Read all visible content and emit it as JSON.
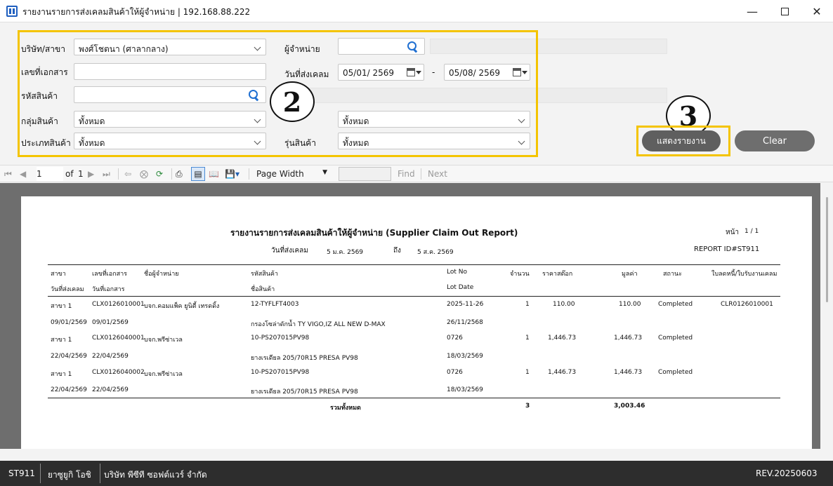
{
  "window": {
    "title": "รายงานรายการส่งเคลมสินค้าให้ผู้จำหน่าย | 192.168.88.222",
    "minimize_icon": "minimize-icon",
    "maximize_icon": "maximize-icon",
    "close_icon": "close-icon"
  },
  "filters": {
    "branch_label": "บริษัท/สาขา",
    "branch_value": "พงศ์โชตนา (ศาลากลาง)",
    "doc_no_label": "เลขที่เอกสาร",
    "doc_no_value": "",
    "product_code_label": "รหัสสินค้า",
    "product_code_value": "",
    "product_group_label": "กลุ่มสินค้า",
    "product_group_value": "ทั้งหมด",
    "product_type_label": "ประเภทสินค้า",
    "product_type_value": "ทั้งหมด",
    "supplier_label": "ผู้จำหน่าย",
    "supplier_value": "",
    "date_label": "วันที่ส่งเคลม",
    "date_from": "05/01/  2569",
    "date_sep": "-",
    "date_to": "05/08/  2569",
    "brand_value": "ทั้งหมด",
    "model_label": "รุ่นสินค้า",
    "model_value": "ทั้งหมด"
  },
  "callouts": {
    "filters": "2",
    "show_button": "3"
  },
  "buttons": {
    "show_report": "แสดงรายงาน",
    "clear": "Clear"
  },
  "colors": {
    "highlight": "#f4c400",
    "show_button": "#5f5f5f",
    "clear_button": "#6e6e6e",
    "status_bar": "#2d2d2d"
  },
  "viewer_toolbar": {
    "page_current": "1",
    "page_of": "of",
    "page_total": "1",
    "zoom": "Page Width",
    "find_placeholder": "",
    "find_label": "Find",
    "next_label": "Next"
  },
  "report": {
    "title": "รายงานรายการส่งเคลมสินค้าให้ผู้จำหน่าย (Supplier Claim Out Report)",
    "page_label": "หน้า",
    "page_value": "1 / 1",
    "date_range_label": "วันที่ส่งเคลม",
    "date_from": "5 ม.ค. 2569",
    "to_label": "ถึง",
    "date_to": "5 ส.ค. 2569",
    "report_id": "REPORT ID#ST911",
    "headers": {
      "branch": "สาขา",
      "doc_no": "เลขที่เอกสาร",
      "supplier": "ชื่อผู้จำหน่าย",
      "product_code": "รหัสสินค้า",
      "lot_no": "Lot No",
      "qty": "จำนวน",
      "cost": "ราคาสต๊อก",
      "amount": "มูลค่า",
      "status": "สถานะ",
      "receipt": "ใบลดหนี้/ใบรับงานเคลม",
      "claim_date": "วันที่ส่งเคลม",
      "doc_date": "วันที่เอกสาร",
      "product_name": "ชื่อสินค้า",
      "lot_date": "Lot Date"
    },
    "rows": [
      {
        "branch": "สาขา 1",
        "doc_no": "CLX0126010001",
        "supplier": "บจก.คอมแพ็ค ยูนิตี้ เทรดดิ้ง",
        "product_code": "12-TYFLFT4003",
        "lot_no": "2025-11-26",
        "qty": "1",
        "cost": "110.00",
        "amount": "110.00",
        "status": "Completed",
        "receipt": "CLR0126010001",
        "claim_date": "09/01/2569",
        "doc_date": "09/01/2569",
        "product_name": "กรองโซล่าดักน้ำ TY VIGO,IZ ALL NEW D-MAX",
        "lot_date": "26/11/2568"
      },
      {
        "branch": "สาขา 1",
        "doc_no": "CLX0126040001",
        "supplier": "บจก.พรีซ่าเวล",
        "product_code": "10-PS207015PV98",
        "lot_no": "0726",
        "qty": "1",
        "cost": "1,446.73",
        "amount": "1,446.73",
        "status": "Completed",
        "receipt": "",
        "claim_date": "22/04/2569",
        "doc_date": "22/04/2569",
        "product_name": "ยางเรเดียล 205/70R15 PRESA PV98",
        "lot_date": "18/03/2569"
      },
      {
        "branch": "สาขา 1",
        "doc_no": "CLX0126040002",
        "supplier": "บจก.พรีซ่าเวล",
        "product_code": "10-PS207015PV98",
        "lot_no": "0726",
        "qty": "1",
        "cost": "1,446.73",
        "amount": "1,446.73",
        "status": "Completed",
        "receipt": "",
        "claim_date": "22/04/2569",
        "doc_date": "22/04/2569",
        "product_name": "ยางเรเดียล 205/70R15 PRESA PV98",
        "lot_date": "18/03/2569"
      }
    ],
    "total_label": "รวมทั้งหมด",
    "total_qty": "3",
    "total_amount": "3,003.46"
  },
  "status_bar": {
    "report_code": "ST911",
    "user": "ยาซูยูกิ  โอชิ",
    "company": "บริษัท พีซีที ซอฟต์แวร์ จำกัด",
    "revision": "REV.20250603"
  }
}
